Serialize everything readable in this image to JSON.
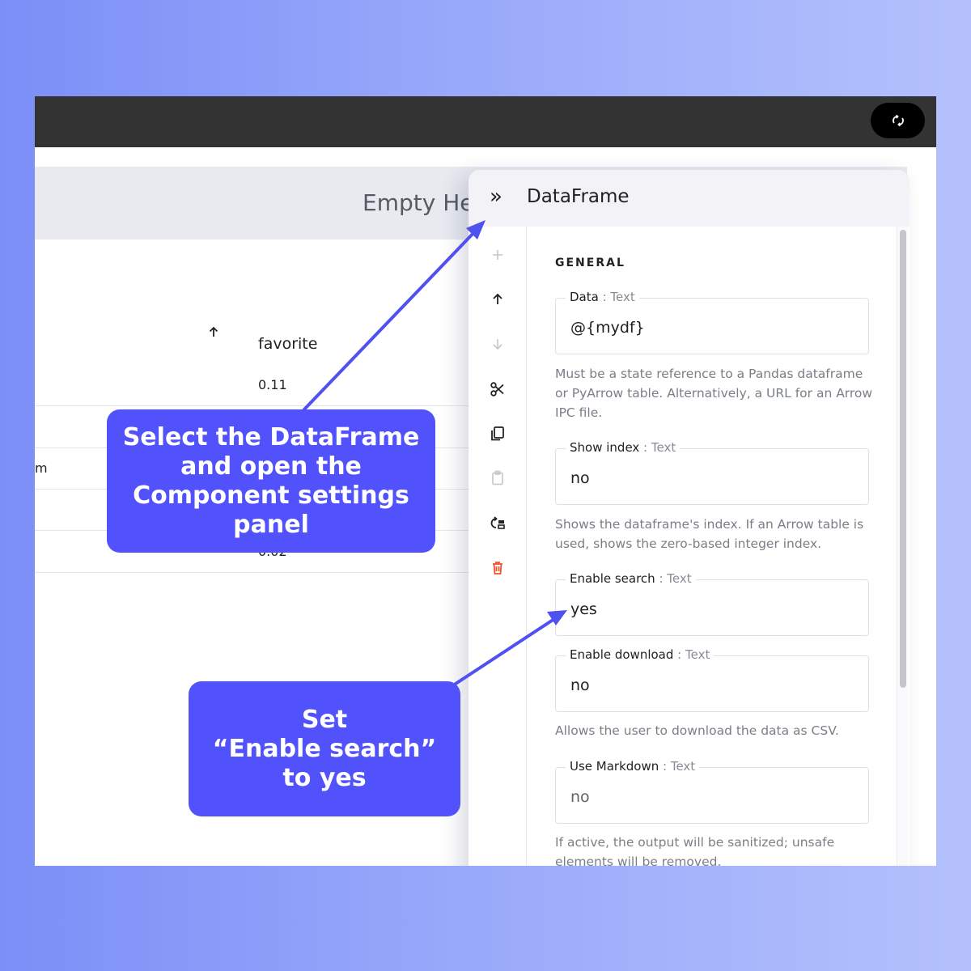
{
  "app": {
    "header_title": "Empty He",
    "table": {
      "column_header": "favorite",
      "cells": [
        {
          "value": "0.11"
        },
        {
          "value": "m"
        },
        {
          "value": "0.02"
        }
      ]
    }
  },
  "topbar": {
    "button_icon": "refresh-icon"
  },
  "settings_panel": {
    "title": "DataFrame",
    "collapse_glyph": "»",
    "toolbar_icons": [
      "add-icon",
      "move-up-icon",
      "move-down-icon",
      "cut-icon",
      "copy-icon",
      "paste-icon",
      "go-to-parent-icon",
      "delete-icon"
    ],
    "section_title": "GENERAL",
    "fields": [
      {
        "label": "Data",
        "type": " : Text",
        "value": "@{mydf}",
        "help": "Must be a state reference to a Pandas dataframe or PyArrow table. Alternatively, a URL for an Arrow IPC file."
      },
      {
        "label": "Show index",
        "type": " : Text",
        "value": "no",
        "help": "Shows the dataframe's index. If an Arrow table is used, shows the zero-based integer index."
      },
      {
        "label": "Enable search",
        "type": " : Text",
        "value": "yes",
        "help": ""
      },
      {
        "label": "Enable download",
        "type": " : Text",
        "value": "no",
        "help": "Allows the user to download the data as CSV."
      },
      {
        "label": "Use Markdown",
        "type": " : Text",
        "value": "no",
        "help": "If active, the output will be sanitized; unsafe elements will be removed."
      }
    ]
  },
  "callouts": {
    "step1": "Select the DataFrame\nand open the\nComponent settings\npanel",
    "step2": "Set\n“Enable search”\nto yes"
  },
  "colors": {
    "callout": "#5152fb",
    "arrow": "#4f51f0",
    "topbar": "#333333",
    "delete": "#e8552b"
  }
}
